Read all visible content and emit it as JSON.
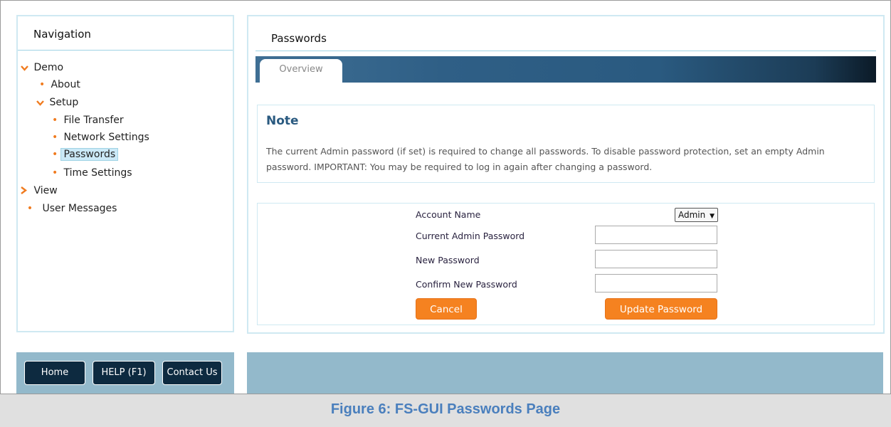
{
  "navigation": {
    "title": "Navigation",
    "items": [
      {
        "label": "Demo",
        "marker": "chevron-down"
      },
      {
        "label": "About",
        "marker": "bullet"
      },
      {
        "label": "Setup",
        "marker": "chevron-down"
      },
      {
        "label": "File Transfer",
        "marker": "bullet"
      },
      {
        "label": "Network Settings",
        "marker": "bullet"
      },
      {
        "label": "Passwords",
        "marker": "bullet",
        "selected": true
      },
      {
        "label": "Time Settings",
        "marker": "bullet"
      },
      {
        "label": "View",
        "marker": "chevron-right"
      },
      {
        "label": "User Messages",
        "marker": "bullet"
      }
    ]
  },
  "main": {
    "title": "Passwords",
    "tabs": [
      {
        "label": "Overview"
      }
    ],
    "note": {
      "title": "Note",
      "text": "The current Admin password (if set) is required to change all passwords. To disable password protection, set an empty Admin password. IMPORTANT: You may be required to log in again after changing a password."
    },
    "form": {
      "account_name_label": "Account Name",
      "account_name_value": "Admin",
      "current_password_label": "Current Admin Password",
      "new_password_label": "New Password",
      "confirm_password_label": "Confirm New Password",
      "current_password_value": "",
      "new_password_value": "",
      "confirm_password_value": "",
      "cancel_label": "Cancel",
      "update_label": "Update Password"
    }
  },
  "footer": {
    "home_label": "Home",
    "help_label": "HELP (F1)",
    "contact_label": "Contact Us"
  },
  "caption": "Figure 6: FS-GUI Passwords Page",
  "colors": {
    "accent_orange": "#f58220",
    "panel_border": "#cfe9f2",
    "note_title": "#2a5a80",
    "footer_bg": "#93b9cb",
    "footer_button": "#0d2a40",
    "caption": "#4a7fbd"
  }
}
